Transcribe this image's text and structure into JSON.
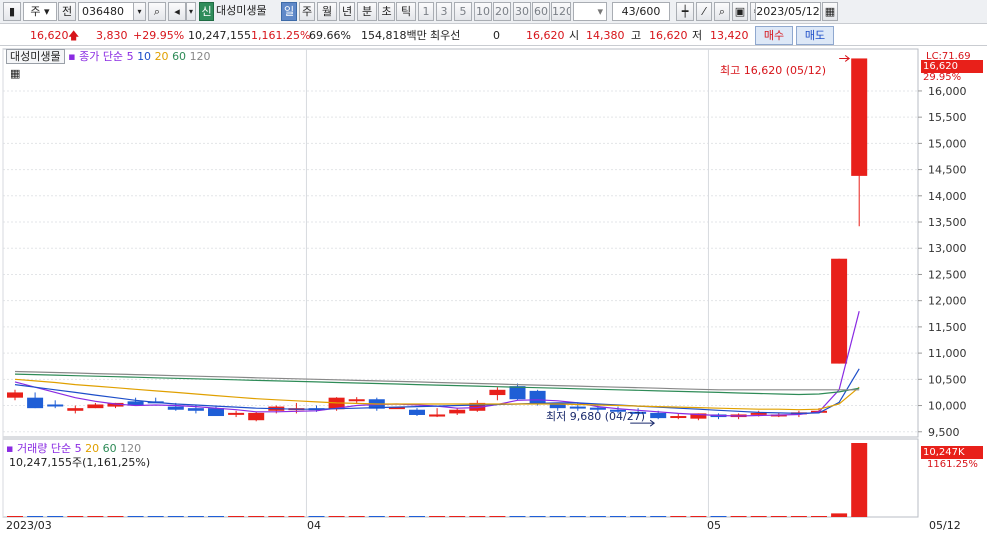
{
  "toolbar": {
    "market": "주",
    "scope": "전",
    "code": "036480",
    "new_badge": "신",
    "stock_name": "대성미생물",
    "periods": [
      "일",
      "주",
      "월",
      "년",
      "분",
      "초",
      "틱"
    ],
    "active_period": "일",
    "intervals": [
      "1",
      "3",
      "5",
      "10",
      "20",
      "30",
      "60",
      "120"
    ],
    "count": "43",
    "count_max": "/600",
    "date": "2023/05/12"
  },
  "info": {
    "price": "16,620",
    "change": "3,830",
    "change_pct": "+29.95%",
    "volume": "10,247,155",
    "volume_pct": "1,161.25%",
    "turnover": "69.66%",
    "amount": "154,818백만",
    "pref_label": "최우선",
    "pref_value": "0",
    "pref_price": "16,620",
    "open_label": "시",
    "open": "14,380",
    "high_label": "고",
    "high": "16,620",
    "low_label": "저",
    "low": "13,420",
    "buy_label": "매수",
    "sell_label": "매도"
  },
  "price_panel": {
    "name_tag": "대성미생물",
    "ma_label": "종가 단순",
    "ma_periods": [
      "5",
      "10",
      "20",
      "60",
      "120"
    ],
    "ma_colors": [
      "#8a2be2",
      "#1d4ec9",
      "#e0a000",
      "#2e8b57",
      "#888888"
    ],
    "lc_label": "LC:71.69",
    "last_price_tag": "16,620",
    "last_pct_tag": "29.95%",
    "high_annotation": "최고 16,620 (05/12)",
    "low_annotation": "최저 9,680 (04/27)",
    "axis_ticks": [
      "16,000",
      "15,500",
      "15,000",
      "14,500",
      "14,000",
      "13,500",
      "13,000",
      "12,500",
      "12,000",
      "11,500",
      "11,000",
      "10,500",
      "10,000",
      "9,500"
    ]
  },
  "volume_panel": {
    "title": "거래량",
    "ma_label": "단순",
    "ma_periods": [
      "5",
      "20",
      "60",
      "120"
    ],
    "ma_colors": [
      "#8a2be2",
      "#e0a000",
      "#2e8b57",
      "#888888"
    ],
    "value_line": "10,247,155주(1,161,25%)",
    "tag_value": "10,247K",
    "tag_pct": "1161.25%"
  },
  "x_axis": {
    "labels": [
      "2023/03",
      "04",
      "05"
    ],
    "right_label": "05/12"
  },
  "chart_data": {
    "type": "candlestick",
    "note_colors": {
      "up": "#e8201a",
      "down": "#1f5ed6"
    },
    "candles": [
      {
        "o": 10150,
        "h": 10300,
        "l": 10100,
        "c": 10250
      },
      {
        "o": 10150,
        "h": 10250,
        "l": 9950,
        "c": 9950
      },
      {
        "o": 10020,
        "h": 10100,
        "l": 9950,
        "c": 10000
      },
      {
        "o": 9900,
        "h": 10000,
        "l": 9850,
        "c": 9950
      },
      {
        "o": 9950,
        "h": 10050,
        "l": 9950,
        "c": 10020
      },
      {
        "o": 9980,
        "h": 10050,
        "l": 9950,
        "c": 10050
      },
      {
        "o": 10080,
        "h": 10150,
        "l": 10000,
        "c": 10000
      },
      {
        "o": 10080,
        "h": 10150,
        "l": 10050,
        "c": 10050
      },
      {
        "o": 9980,
        "h": 10050,
        "l": 9900,
        "c": 9920
      },
      {
        "o": 9950,
        "h": 10000,
        "l": 9850,
        "c": 9900
      },
      {
        "o": 9950,
        "h": 9980,
        "l": 9800,
        "c": 9800
      },
      {
        "o": 9830,
        "h": 9900,
        "l": 9780,
        "c": 9860
      },
      {
        "o": 9720,
        "h": 9880,
        "l": 9700,
        "c": 9860
      },
      {
        "o": 9900,
        "h": 10000,
        "l": 9850,
        "c": 9980
      },
      {
        "o": 9950,
        "h": 10050,
        "l": 9850,
        "c": 9950
      },
      {
        "o": 9950,
        "h": 10000,
        "l": 9880,
        "c": 9920
      },
      {
        "o": 9930,
        "h": 10160,
        "l": 9900,
        "c": 10150
      },
      {
        "o": 10120,
        "h": 10160,
        "l": 10050,
        "c": 10120
      },
      {
        "o": 10120,
        "h": 10150,
        "l": 9900,
        "c": 9940
      },
      {
        "o": 9960,
        "h": 9980,
        "l": 9950,
        "c": 9970
      },
      {
        "o": 9920,
        "h": 9950,
        "l": 9800,
        "c": 9820
      },
      {
        "o": 9790,
        "h": 9950,
        "l": 9780,
        "c": 9830
      },
      {
        "o": 9850,
        "h": 9950,
        "l": 9820,
        "c": 9920
      },
      {
        "o": 9900,
        "h": 10100,
        "l": 9880,
        "c": 10050
      },
      {
        "o": 10200,
        "h": 10350,
        "l": 10100,
        "c": 10300
      },
      {
        "o": 10370,
        "h": 10420,
        "l": 10100,
        "c": 10120
      },
      {
        "o": 10280,
        "h": 10300,
        "l": 10000,
        "c": 10020
      },
      {
        "o": 10020,
        "h": 10050,
        "l": 9900,
        "c": 9950
      },
      {
        "o": 9980,
        "h": 10050,
        "l": 9900,
        "c": 9950
      },
      {
        "o": 9960,
        "h": 10000,
        "l": 9880,
        "c": 9920
      },
      {
        "o": 9920,
        "h": 9980,
        "l": 9850,
        "c": 9900
      },
      {
        "o": 9880,
        "h": 9950,
        "l": 9820,
        "c": 9860
      },
      {
        "o": 9860,
        "h": 9900,
        "l": 9740,
        "c": 9760
      },
      {
        "o": 9800,
        "h": 9850,
        "l": 9740,
        "c": 9800
      },
      {
        "o": 9750,
        "h": 9850,
        "l": 9720,
        "c": 9850
      },
      {
        "o": 9830,
        "h": 9850,
        "l": 9740,
        "c": 9780
      },
      {
        "o": 9780,
        "h": 9850,
        "l": 9740,
        "c": 9830
      },
      {
        "o": 9830,
        "h": 9900,
        "l": 9790,
        "c": 9860
      },
      {
        "o": 9800,
        "h": 9850,
        "l": 9780,
        "c": 9830
      },
      {
        "o": 9840,
        "h": 9900,
        "l": 9780,
        "c": 9870
      },
      {
        "o": 9900,
        "h": 9950,
        "l": 9900,
        "c": 9900
      },
      {
        "o": 10800,
        "h": 12800,
        "l": 10800,
        "c": 12800
      },
      {
        "o": 14380,
        "h": 16620,
        "l": 13420,
        "c": 16620
      }
    ],
    "volumes": [
      0.02,
      0.02,
      0.02,
      0.02,
      0.02,
      0.02,
      0.02,
      0.02,
      0.02,
      0.02,
      0.02,
      0.02,
      0.02,
      0.02,
      0.02,
      0.02,
      0.02,
      0.02,
      0.02,
      0.02,
      0.02,
      0.02,
      0.02,
      0.02,
      0.02,
      0.02,
      0.02,
      0.02,
      0.02,
      0.02,
      0.02,
      0.02,
      0.02,
      0.02,
      0.02,
      0.02,
      0.02,
      0.02,
      0.02,
      0.02,
      0.02,
      0.5,
      10.247
    ],
    "ma_lines": {
      "ma5": [
        10450,
        10350,
        10250,
        10150,
        10080,
        10030,
        10000,
        10010,
        10000,
        9980,
        9950,
        9920,
        9880,
        9880,
        9890,
        9900,
        9950,
        10000,
        10020,
        10030,
        10010,
        9990,
        9950,
        9960,
        10020,
        10100,
        10110,
        10090,
        10050,
        9980,
        9940,
        9910,
        9880,
        9850,
        9830,
        9810,
        9800,
        9810,
        9820,
        9830,
        9880,
        10300,
        11800
      ],
      "ma10": [
        10400,
        10350,
        10300,
        10250,
        10200,
        10150,
        10100,
        10060,
        10030,
        10010,
        9990,
        9970,
        9950,
        9940,
        9930,
        9930,
        9940,
        9950,
        9960,
        9970,
        9980,
        9990,
        10000,
        10010,
        10020,
        10030,
        10040,
        10050,
        10050,
        10030,
        10010,
        9990,
        9970,
        9950,
        9930,
        9910,
        9890,
        9870,
        9860,
        9850,
        9860,
        10060,
        10700
      ],
      "ma20": [
        10500,
        10470,
        10440,
        10400,
        10370,
        10340,
        10310,
        10280,
        10250,
        10220,
        10190,
        10160,
        10130,
        10110,
        10090,
        10070,
        10050,
        10040,
        10030,
        10030,
        10030,
        10030,
        10030,
        10030,
        10030,
        10030,
        10030,
        10030,
        10020,
        10010,
        10000,
        9990,
        9980,
        9970,
        9960,
        9950,
        9940,
        9930,
        9930,
        9920,
        9930,
        10030,
        10350
      ],
      "ma60": [
        10600,
        10590,
        10580,
        10570,
        10560,
        10550,
        10540,
        10530,
        10520,
        10510,
        10500,
        10490,
        10480,
        10470,
        10460,
        10450,
        10440,
        10430,
        10420,
        10410,
        10400,
        10390,
        10380,
        10370,
        10360,
        10350,
        10340,
        10330,
        10320,
        10310,
        10300,
        10290,
        10280,
        10270,
        10260,
        10250,
        10240,
        10230,
        10220,
        10210,
        10220,
        10260,
        10330
      ],
      "ma120": [
        10650,
        10640,
        10630,
        10620,
        10610,
        10600,
        10590,
        10580,
        10570,
        10560,
        10550,
        10540,
        10530,
        10520,
        10510,
        10500,
        10490,
        10480,
        10470,
        10460,
        10450,
        10440,
        10430,
        10420,
        10410,
        10400,
        10390,
        10380,
        10370,
        10360,
        10350,
        10340,
        10330,
        10320,
        10310,
        10300,
        10300,
        10300,
        10300,
        10300,
        10300,
        10300,
        10300
      ]
    },
    "ylim": [
      9400,
      16800
    ]
  }
}
